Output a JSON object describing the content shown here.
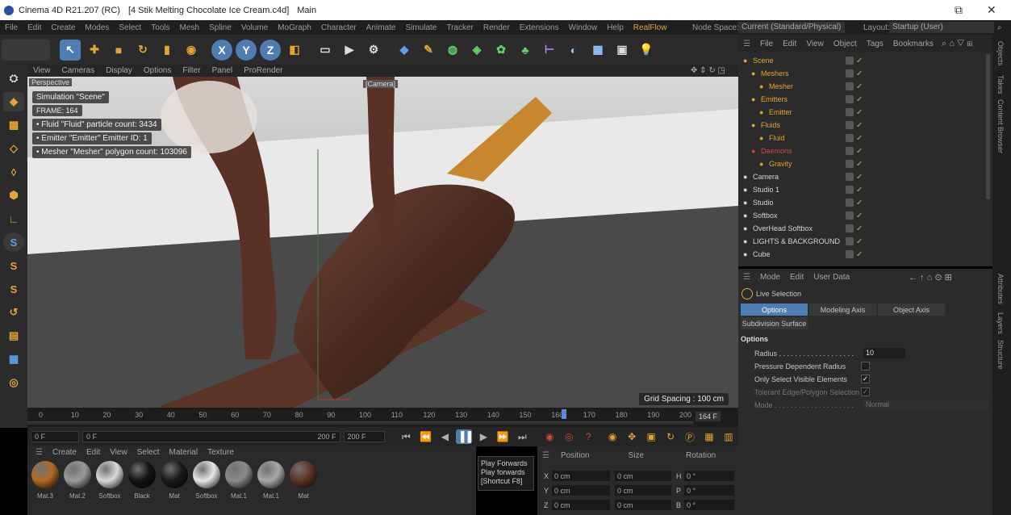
{
  "titlebar": {
    "app": "Cinema 4D R21.207 (RC)",
    "file": "[4 Stik Melting Chocolate Ice Cream.c4d]",
    "mode": "Main",
    "restore_glyph": "⧉",
    "close_glyph": "✕"
  },
  "menubar": {
    "items": [
      "File",
      "Edit",
      "Create",
      "Modes",
      "Select",
      "Tools",
      "Mesh",
      "Spline",
      "Volume",
      "MoGraph",
      "Character",
      "Animate",
      "Simulate",
      "Tracker",
      "Render",
      "Extensions",
      "Window",
      "Help",
      "RealFlow"
    ],
    "node_space_label": "Node Space:",
    "node_space_value": "Current (Standard/Physical)",
    "layout_label": "Layout:",
    "layout_value": "Startup (User)"
  },
  "toolbar": {
    "axis_x": "X",
    "axis_y": "Y",
    "axis_z": "Z"
  },
  "viewport": {
    "menu": [
      "View",
      "Cameras",
      "Display",
      "Options",
      "Filter",
      "Panel",
      "ProRender"
    ],
    "label": "Perspective",
    "camera_tag": "[Camera]",
    "hud": [
      "Simulation \"Scene\"",
      "FRAME: 164",
      "• Fluid \"Fluid\" particle count: 3434",
      "• Emitter \"Emitter\" Emitter ID: 1",
      "• Mesher \"Mesher\" polygon count: 103096"
    ],
    "grid_spacing": "Grid Spacing : 100 cm"
  },
  "timeline": {
    "ticks": [
      "0",
      "10",
      "20",
      "30",
      "40",
      "50",
      "60",
      "70",
      "80",
      "90",
      "100",
      "110",
      "120",
      "130",
      "140",
      "150",
      "160",
      "170",
      "180",
      "190",
      "200"
    ],
    "current_frame_display": "164 F",
    "current_frame": 164,
    "max_frame": 200
  },
  "playbar": {
    "start": "0 F",
    "preview_start": "0 F",
    "preview_end": "200 F",
    "end": "200 F"
  },
  "materials": {
    "menu": [
      "Create",
      "Edit",
      "View",
      "Select",
      "Material",
      "Texture"
    ],
    "items": [
      {
        "label": "Mat.3",
        "color": "#b06a25"
      },
      {
        "label": "Mat.2",
        "color": "#9a9a9a"
      },
      {
        "label": "Softbox",
        "color": "#d8d8d8"
      },
      {
        "label": "Black",
        "color": "#141414"
      },
      {
        "label": "Mat",
        "color": "#191919"
      },
      {
        "label": "Softbox",
        "color": "#e6e6e6"
      },
      {
        "label": "Mat.1",
        "color": "#8a8a8a"
      },
      {
        "label": "Mat.1",
        "color": "#a8a8a8"
      },
      {
        "label": "Mat",
        "color": "#5b3426"
      }
    ]
  },
  "tooltip": {
    "title": "Play Forwards",
    "desc": "Play forwards",
    "shortcut": "[Shortcut F8]"
  },
  "coords": {
    "headers": [
      "Position",
      "Size",
      "Rotation"
    ],
    "rows": [
      {
        "axis": "X",
        "pos": "0 cm",
        "size": "0 cm",
        "rot_axis": "H",
        "rot": "0 °"
      },
      {
        "axis": "Y",
        "pos": "0 cm",
        "size": "0 cm",
        "rot_axis": "P",
        "rot": "0 °"
      },
      {
        "axis": "Z",
        "pos": "0 cm",
        "size": "0 cm",
        "rot_axis": "B",
        "rot": "0 °"
      }
    ]
  },
  "objects": {
    "menu": [
      "File",
      "Edit",
      "View",
      "Object",
      "Tags",
      "Bookmarks"
    ],
    "rows": [
      {
        "name": "Scene",
        "indent": 0,
        "color": "#e3a52f"
      },
      {
        "name": "Meshers",
        "indent": 1,
        "color": "#e3a52f"
      },
      {
        "name": "Mesher",
        "indent": 2,
        "color": "#e3a52f"
      },
      {
        "name": "Emitters",
        "indent": 1,
        "color": "#e3a52f"
      },
      {
        "name": "Emitter",
        "indent": 2,
        "color": "#e3a52f"
      },
      {
        "name": "Fluids",
        "indent": 1,
        "color": "#e3a52f"
      },
      {
        "name": "Fluid",
        "indent": 2,
        "color": "#e3a52f"
      },
      {
        "name": "Daemons",
        "indent": 1,
        "color": "#d04a3a"
      },
      {
        "name": "Gravity",
        "indent": 2,
        "color": "#e3a52f"
      },
      {
        "name": "Camera",
        "indent": 0,
        "color": "#d6d6d6"
      },
      {
        "name": "Studio 1",
        "indent": 0,
        "color": "#d6d6d6"
      },
      {
        "name": "Studio",
        "indent": 0,
        "color": "#d6d6d6"
      },
      {
        "name": "Softbox",
        "indent": 0,
        "color": "#d6d6d6"
      },
      {
        "name": "OverHead Softbox",
        "indent": 0,
        "color": "#d6d6d6"
      },
      {
        "name": "LIGHTS & BACKGROUND",
        "indent": 0,
        "color": "#d6d6d6"
      },
      {
        "name": "Cube",
        "indent": 0,
        "color": "#d6d6d6"
      }
    ]
  },
  "attributes": {
    "menu": [
      "Mode",
      "Edit",
      "User Data"
    ],
    "tool": "Live Selection",
    "tabs": [
      "Options",
      "Modeling Axis",
      "Object Axis"
    ],
    "tab2": "Subdivision Surface",
    "section": "Options",
    "radius_label": "Radius . . . . . . . . . . . . . . . . . . .",
    "radius_value": "10",
    "pressure_label": "Pressure Dependent Radius",
    "visible_label": "Only Select Visible Elements",
    "tolerant_label": "Tolerant Edge/Polygon Selection",
    "mode_label": "Mode . . . . . . . . . . . . . . . . . . . .",
    "mode_value": "Normal"
  },
  "side_tabs": [
    "Objects",
    "Takes",
    "Content Browser",
    "Attributes",
    "Layers",
    "Structure"
  ],
  "colors": {
    "accent_blue": "#4f7cb3",
    "realflow_orange": "#e3a52f",
    "ui_bg": "#2b2b2b"
  }
}
